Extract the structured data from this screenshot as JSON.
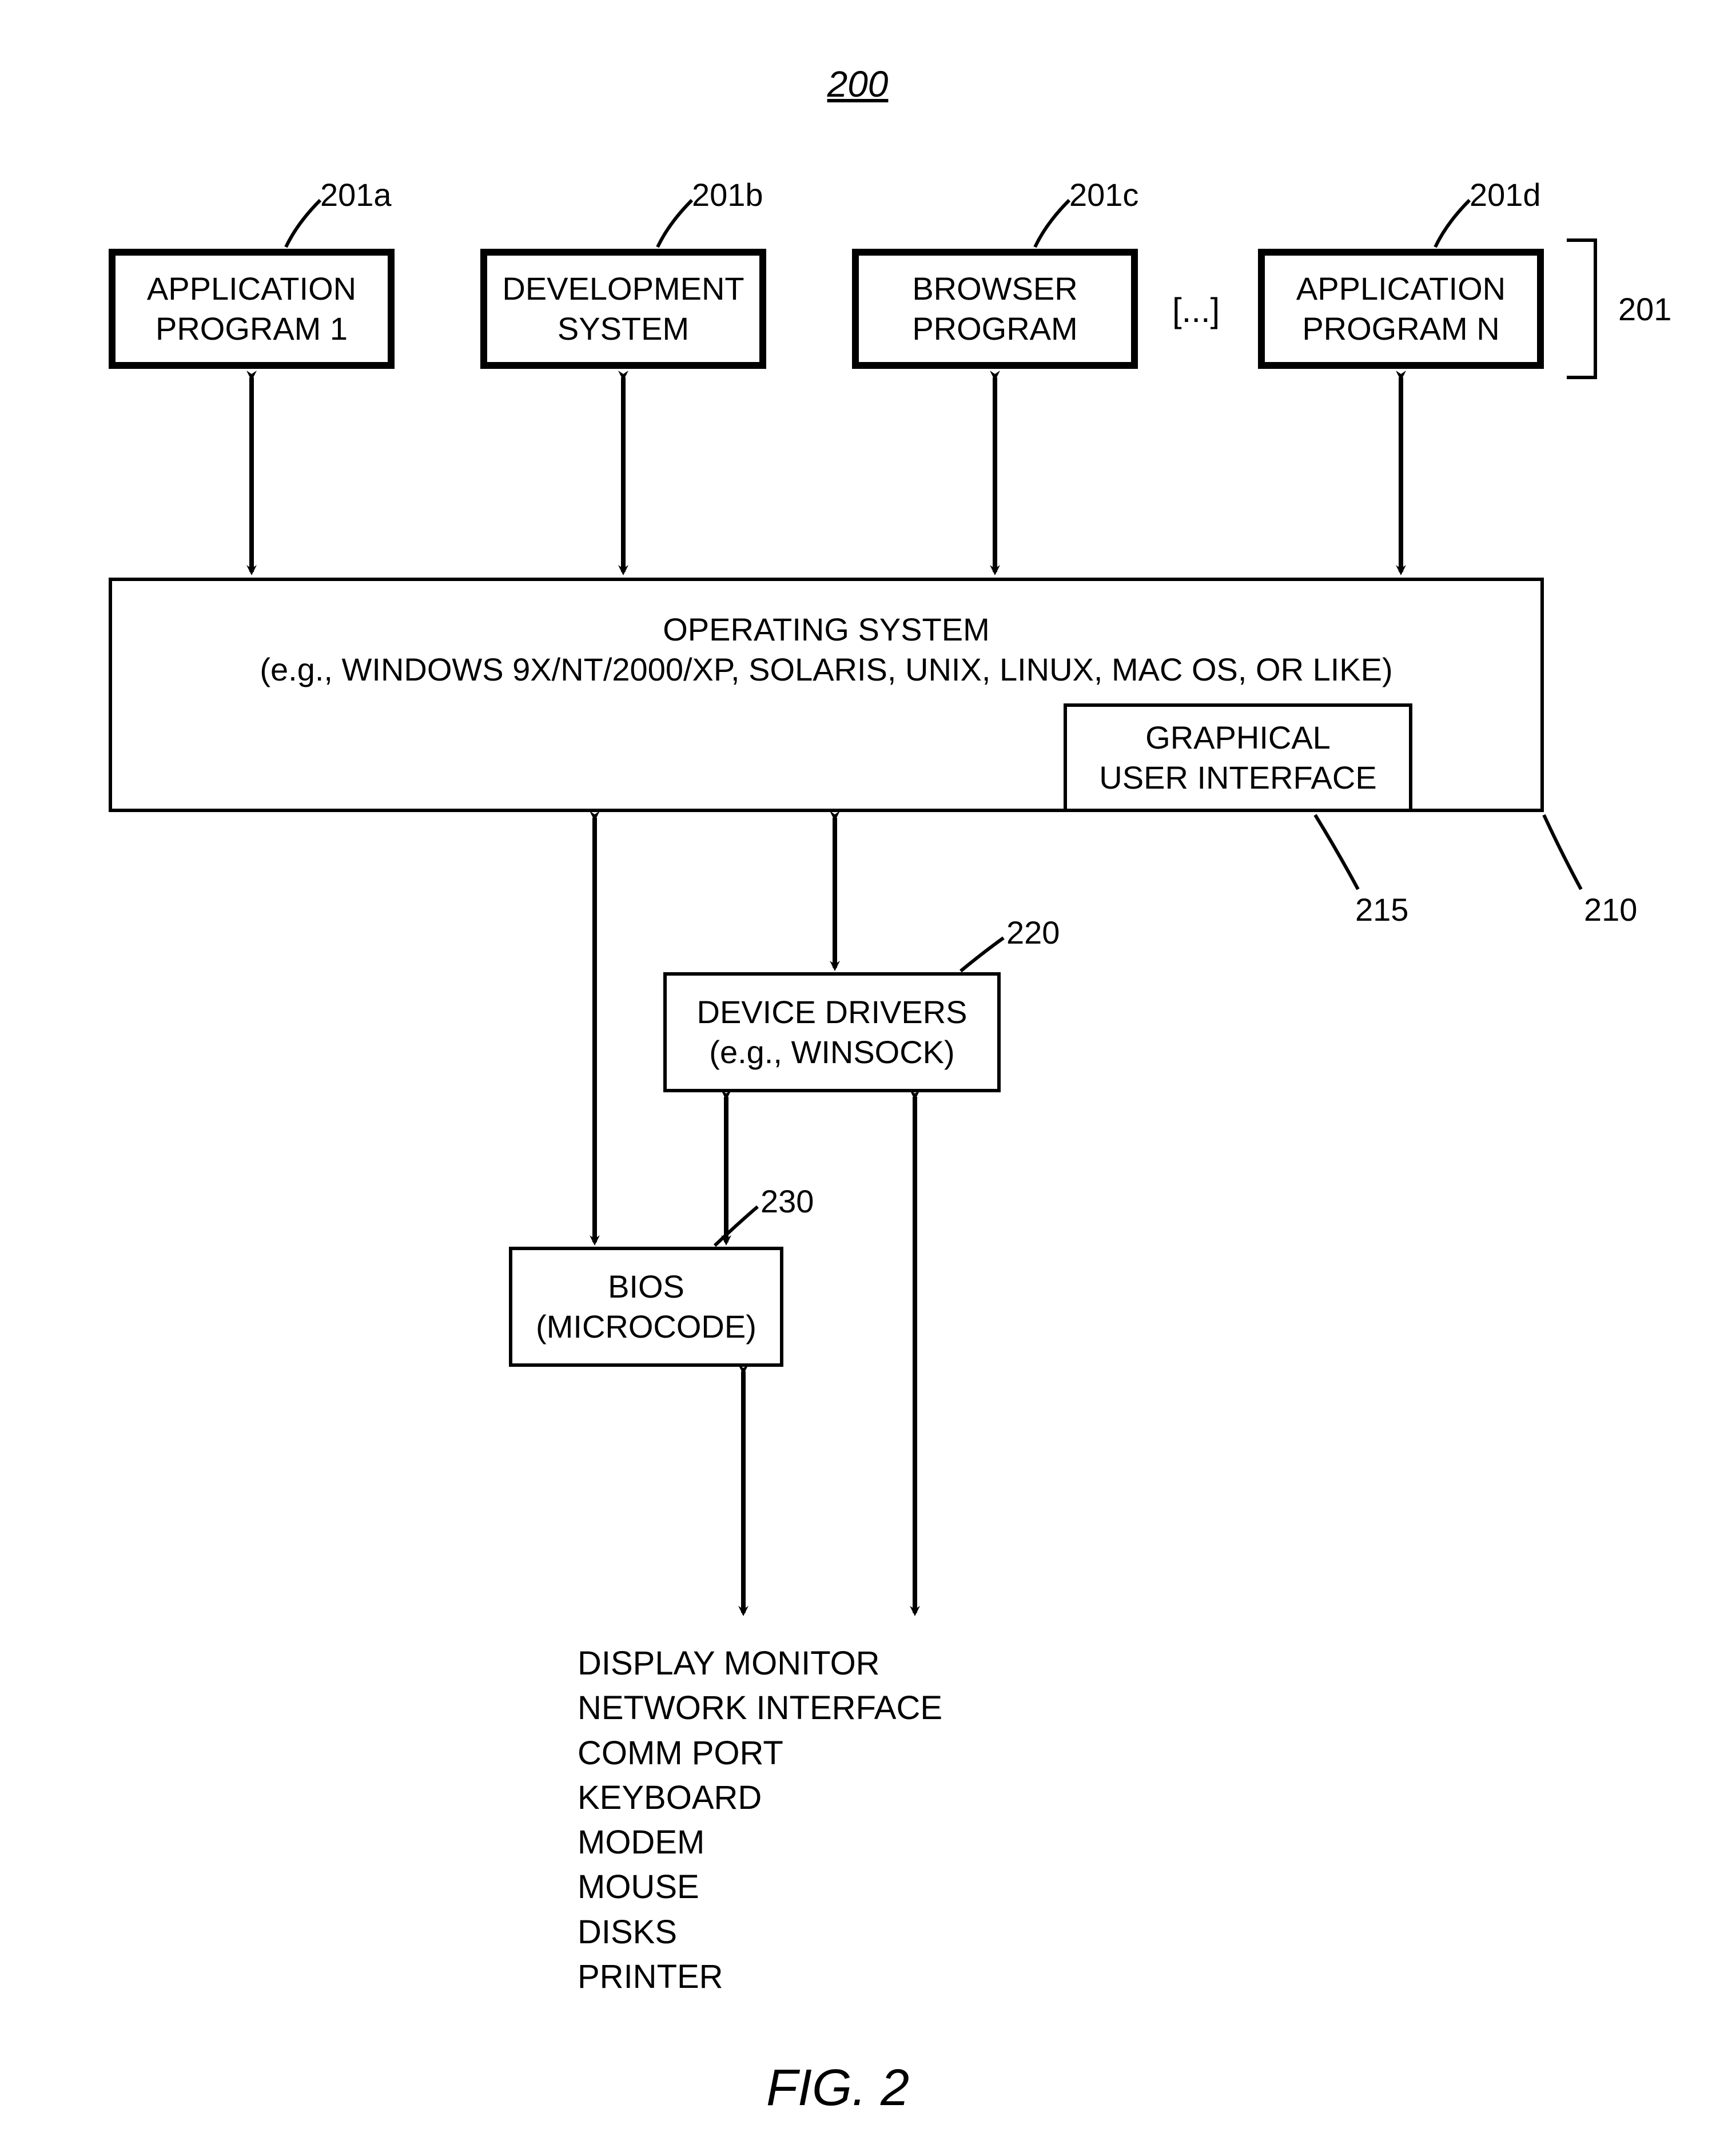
{
  "title": "200",
  "apps": {
    "a": {
      "l1": "APPLICATION",
      "l2": "PROGRAM 1",
      "ref": "201a"
    },
    "b": {
      "l1": "DEVELOPMENT",
      "l2": "SYSTEM",
      "ref": "201b"
    },
    "c": {
      "l1": "BROWSER",
      "l2": "PROGRAM",
      "ref": "201c"
    },
    "d": {
      "l1": "APPLICATION",
      "l2": "PROGRAM N",
      "ref": "201d"
    },
    "ellipsis": "[...]",
    "group_ref": "201"
  },
  "os": {
    "l1": "OPERATING SYSTEM",
    "l2": "(e.g., WINDOWS 9X/NT/2000/XP, SOLARIS, UNIX, LINUX, MAC OS, OR LIKE)",
    "gui_l1": "GRAPHICAL",
    "gui_l2": "USER INTERFACE",
    "ref_os": "210",
    "ref_gui": "215"
  },
  "drivers": {
    "l1": "DEVICE DRIVERS",
    "l2": "(e.g., WINSOCK)",
    "ref": "220"
  },
  "bios": {
    "l1": "BIOS",
    "l2": "(MICROCODE)",
    "ref": "230"
  },
  "devices": {
    "d1": "DISPLAY MONITOR",
    "d2": "NETWORK INTERFACE",
    "d3": "COMM PORT",
    "d4": "KEYBOARD",
    "d5": "MODEM",
    "d6": "MOUSE",
    "d7": "DISKS",
    "d8": "PRINTER"
  },
  "figure": "FIG. 2"
}
